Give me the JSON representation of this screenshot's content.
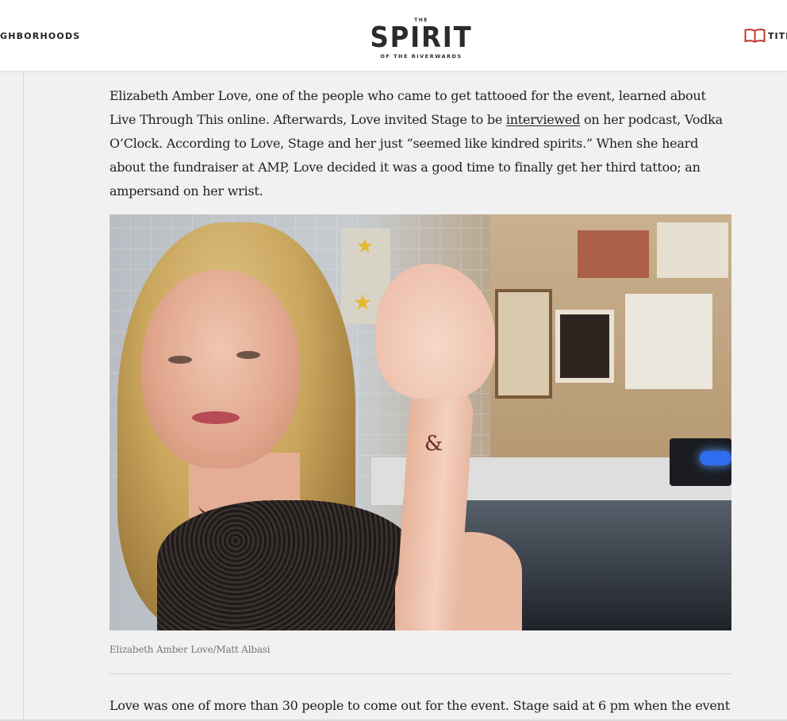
{
  "header": {
    "nav_left_label": "GHBORHOODS",
    "logo": {
      "small_top": "THE",
      "main": "SPIRIT",
      "small_bottom": "OF THE RIVERWARDS"
    },
    "nav_right_label": "TITL",
    "nav_right_icon": "book-icon",
    "accent_color": "#c0392b"
  },
  "article": {
    "para1": {
      "before_link": "Elizabeth Amber Love, one of the people who came to get tattooed for the event, learned about Live Through This online. Afterwards, Love invited Stage to be ",
      "link": "interviewed",
      "after_link": " on her podcast, Vodka O’Clock. According to Love, Stage and her just “seemed like kindred spirits.” When she heard about the fundraiser at AMP, Love decided it was a good time to finally get her third tattoo; an ampersand on her wrist."
    },
    "tattoo_glyph": "&",
    "caption": "Elizabeth Amber Love/Matt Albasi",
    "para2": "Love was one of more than 30 people to come out for the event. Stage said at 6 pm when the event"
  }
}
